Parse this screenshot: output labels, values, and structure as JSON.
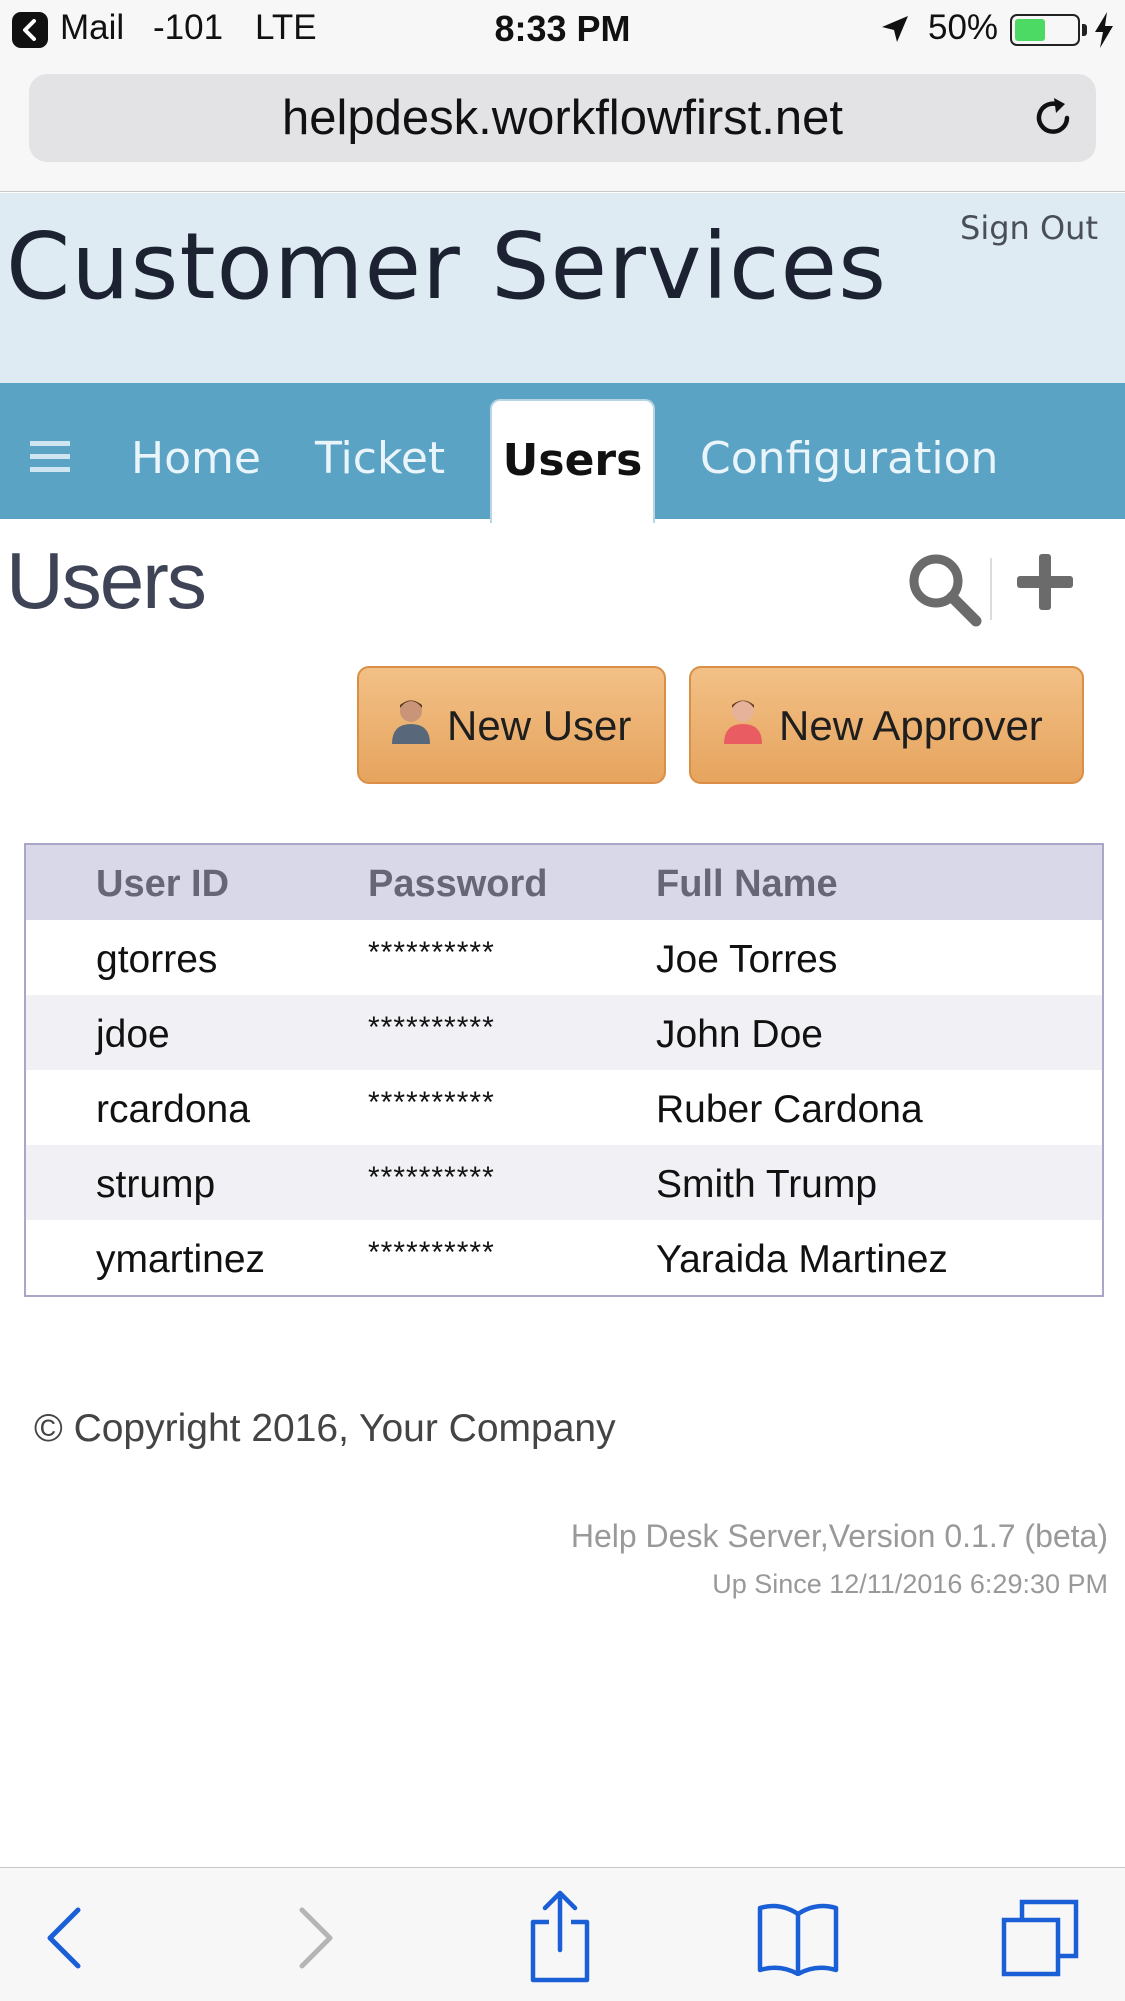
{
  "status_bar": {
    "carrier": "Mail",
    "signal": "-101",
    "network": "LTE",
    "time": "8:33 PM",
    "battery_percent": "50%",
    "battery_level": 0.5
  },
  "browser": {
    "url": "helpdesk.workflowfirst.net"
  },
  "header": {
    "title": "Customer Services",
    "sign_out": "Sign Out"
  },
  "nav": {
    "items": [
      {
        "label": "Home"
      },
      {
        "label": "Ticket"
      },
      {
        "label": "Users"
      },
      {
        "label": "Configuration"
      }
    ],
    "active": "Users"
  },
  "page": {
    "title": "Users"
  },
  "buttons": {
    "new_user": "New User",
    "new_approver": "New Approver"
  },
  "table": {
    "headers": [
      "User ID",
      "Password",
      "Full Name"
    ],
    "rows": [
      [
        "gtorres",
        "**********",
        "Joe Torres"
      ],
      [
        "jdoe",
        "**********",
        "John Doe"
      ],
      [
        "rcardona",
        "**********",
        "Ruber Cardona"
      ],
      [
        "strump",
        "**********",
        "Smith Trump"
      ],
      [
        "ymartinez",
        "**********",
        "Yaraida Martinez"
      ]
    ]
  },
  "footer": {
    "copyright": "© Copyright 2016, Your Company",
    "server": "Help Desk Server,Version 0.1.7 (beta)",
    "up_since": "Up Since 12/11/2016 6:29:30 PM"
  },
  "colors": {
    "header_bg": "#deebf3",
    "nav_bg": "#5ba3c4",
    "button_orange": "#e6a45e",
    "ios_blue": "#1a73e8"
  },
  "icons": [
    "back-app-icon",
    "location-arrow-icon",
    "battery-icon",
    "charging-bolt-icon",
    "reload-icon",
    "hamburger-icon",
    "search-icon",
    "plus-icon",
    "user-icon",
    "approver-icon",
    "back-arrow-icon",
    "forward-arrow-icon",
    "share-icon",
    "bookmarks-icon",
    "tabs-icon"
  ]
}
